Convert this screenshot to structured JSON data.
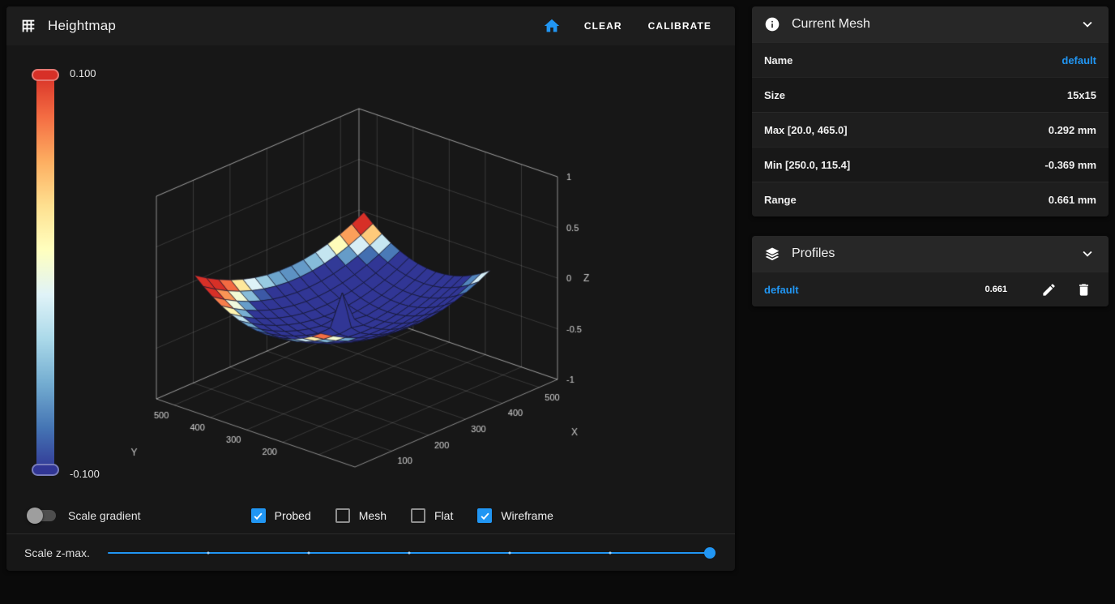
{
  "colors": {
    "accent": "#2196f3",
    "page_bg": "#0a0a0a",
    "card_header_bg": "#272727"
  },
  "heightmap_panel": {
    "title": "Heightmap",
    "toolbar": {
      "clear": "CLEAR",
      "calibrate": "CALIBRATE"
    },
    "colorbar": {
      "max_label": "0.100",
      "min_label": "-0.100"
    },
    "controls": {
      "scale_gradient": "Scale gradient",
      "checkboxes": [
        {
          "label": "Probed",
          "checked": true
        },
        {
          "label": "Mesh",
          "checked": false
        },
        {
          "label": "Flat",
          "checked": false
        },
        {
          "label": "Wireframe",
          "checked": true
        }
      ]
    },
    "zmax": {
      "label": "Scale z-max.",
      "value": 1
    }
  },
  "chart_data": {
    "type": "surface",
    "x_label": "X",
    "y_label": "Y",
    "z_label": "Z",
    "x_ticks": [
      100,
      200,
      300,
      400,
      500
    ],
    "y_ticks": [
      200,
      300,
      400,
      500
    ],
    "z_ticks": [
      "1",
      "0.5",
      "0",
      "-0.5",
      "-1"
    ],
    "x_range": [
      0,
      550
    ],
    "y_range": [
      0,
      550
    ],
    "z_range": [
      -1,
      1
    ],
    "color_limits": [
      -0.1,
      0.1
    ],
    "colormap_low_to_high": [
      "#313695",
      "#4575b4",
      "#74add1",
      "#abd9e9",
      "#e0f3f8",
      "#ffffbf",
      "#fee090",
      "#fdae61",
      "#f46d43",
      "#d73027"
    ],
    "mesh": {
      "size": "15x15",
      "grid": 15,
      "min_mm": -0.369,
      "max_mm": 0.292,
      "range_mm": 0.661,
      "max_at": [
        20.0,
        465.0
      ],
      "min_at": [
        250.0,
        115.4
      ]
    }
  },
  "current_mesh": {
    "title": "Current Mesh",
    "rows": [
      {
        "label": "Name",
        "value": "default"
      },
      {
        "label": "Size",
        "value": "15x15"
      },
      {
        "label": "Max [20.0, 465.0]",
        "value": "0.292 mm"
      },
      {
        "label": "Min [250.0, 115.4]",
        "value": "-0.369 mm"
      },
      {
        "label": "Range",
        "value": "0.661 mm"
      }
    ]
  },
  "profiles": {
    "title": "Profiles",
    "items": [
      {
        "name": "default",
        "range": "0.661"
      }
    ]
  }
}
